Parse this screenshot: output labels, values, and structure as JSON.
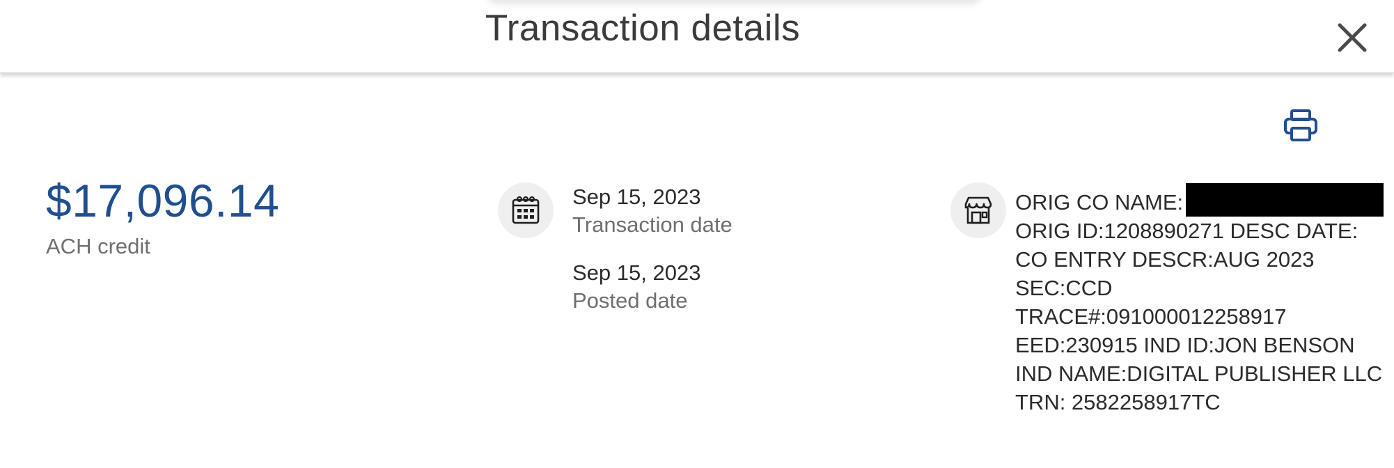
{
  "header": {
    "title": "Transaction details",
    "close_icon": "close-icon"
  },
  "toolbar": {
    "print_icon": "printer-icon"
  },
  "summary": {
    "amount": "$17,096.14",
    "type": "ACH credit",
    "amount_color": "#1f4f8f"
  },
  "dates": {
    "icon": "calendar-icon",
    "transaction_date": "Sep 15, 2023",
    "transaction_label": "Transaction date",
    "posted_date": "Sep 15, 2023",
    "posted_label": "Posted date"
  },
  "details": {
    "icon": "storefront-icon",
    "lines": [
      "ORIG CO NAME:",
      "ORIG ID:1208890271 DESC DATE:",
      "CO ENTRY DESCR:AUG 2023",
      "SEC:CCD",
      "TRACE#:091000012258917",
      "EED:230915 IND ID:JON BENSON",
      "IND NAME:DIGITAL PUBLISHER LLC",
      "TRN: 2582258917TC"
    ]
  }
}
